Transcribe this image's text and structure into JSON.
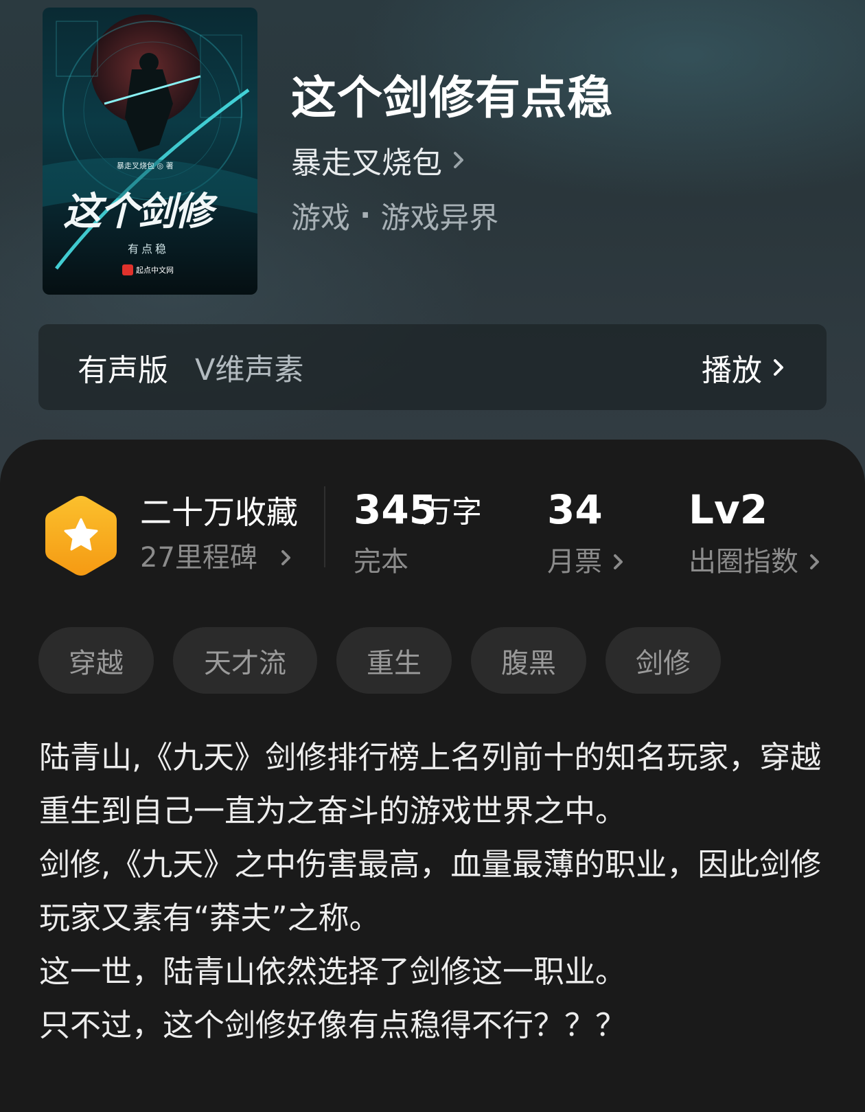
{
  "book": {
    "title": "这个剑修有点稳",
    "author": "暴走叉烧包",
    "genre_primary": "游戏",
    "genre_separator": "·",
    "genre_secondary": "游戏异界",
    "cover": {
      "author_line": "暴走叉烧包 ◎ 著",
      "title_art": "这个剑修",
      "subtitle_art": "有点稳",
      "publisher": "起点中文网"
    }
  },
  "audio": {
    "label": "有声版",
    "narrator": "V维声素",
    "play_label": "播放"
  },
  "stats": {
    "collection_title": "二十万收藏",
    "milestone": "27里程碑",
    "word_count_number": "345",
    "word_count_unit": "万字",
    "status": "完本",
    "monthly_tickets_value": "34",
    "monthly_tickets_label": "月票",
    "level_value": "Lv2",
    "level_label": "出圈指数"
  },
  "tags": [
    "穿越",
    "天才流",
    "重生",
    "腹黑",
    "剑修"
  ],
  "synopsis": [
    "陆青山,《九天》剑修排行榜上名列前十的知名玩家，穿越重生到自己一直为之奋斗的游戏世界之中。",
    "剑修,《九天》之中伤害最高，血量最薄的职业，因此剑修玩家又素有“莽夫”之称。",
    "这一世，陆青山依然选择了剑修这一职业。",
    "只不过，这个剑修好像有点稳得不行？？？"
  ],
  "colors": {
    "badge_gold": "#f7a61c",
    "card_background": "#1a1a1a",
    "tag_background": "#2b2b2b"
  },
  "icons": {
    "chevron": "chevron-right-icon",
    "badge": "star-hexagon-icon"
  }
}
